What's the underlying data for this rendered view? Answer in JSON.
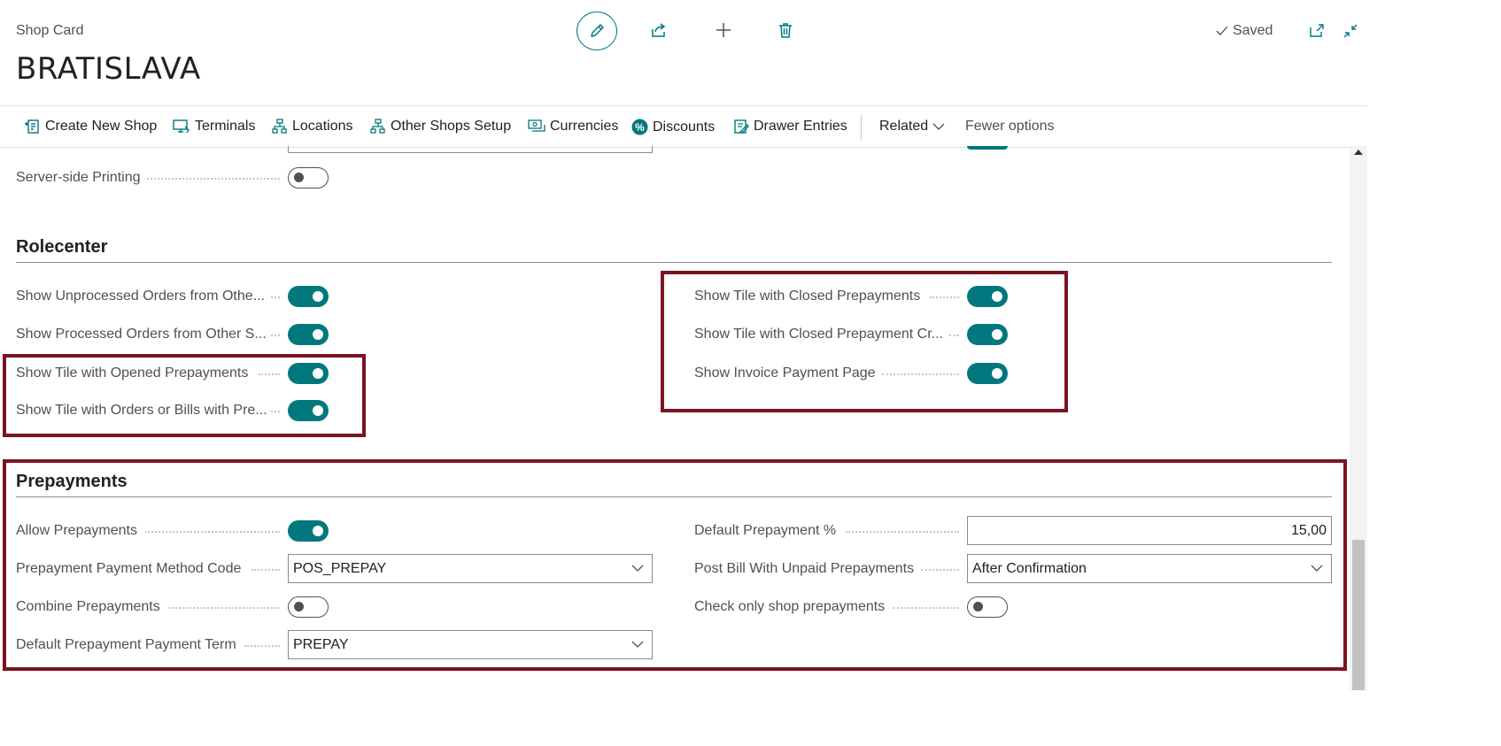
{
  "header": {
    "caption": "Shop Card",
    "title": "BRATISLAVA",
    "status": "Saved"
  },
  "actions": [
    {
      "label": "Create New Shop",
      "icon": "create-document-icon"
    },
    {
      "label": "Terminals",
      "icon": "terminal-icon"
    },
    {
      "label": "Locations",
      "icon": "hierarchy-icon"
    },
    {
      "label": "Other Shops Setup",
      "icon": "hierarchy-icon"
    },
    {
      "label": "Currencies",
      "icon": "currency-icon"
    },
    {
      "label": "Discounts",
      "icon": "percent-icon"
    },
    {
      "label": "Drawer Entries",
      "icon": "entries-icon"
    }
  ],
  "related": "Related",
  "fewer_options": "Fewer options",
  "general": {
    "server_printing": {
      "label": "Server-side Printing",
      "value": false
    }
  },
  "rolecenter": {
    "title": "Rolecenter",
    "left": [
      {
        "label": "Show Unprocessed Orders from Othe...",
        "value": true
      },
      {
        "label": "Show Processed Orders from Other S...",
        "value": true
      },
      {
        "label": "Show Tile with Opened Prepayments",
        "value": true
      },
      {
        "label": "Show Tile with Orders or Bills with Pre...",
        "value": true
      }
    ],
    "right": [
      {
        "label": "Show Tile with Closed Prepayments",
        "value": true
      },
      {
        "label": "Show Tile with Closed Prepayment Cr...",
        "value": true
      },
      {
        "label": "Show Invoice Payment Page",
        "value": true
      }
    ]
  },
  "prepayments": {
    "title": "Prepayments",
    "allow": {
      "label": "Allow Prepayments",
      "value": true
    },
    "method_code": {
      "label": "Prepayment Payment Method Code",
      "value": "POS_PREPAY"
    },
    "combine": {
      "label": "Combine Prepayments",
      "value": false
    },
    "payment_term": {
      "label": "Default Prepayment Payment Term",
      "value": "PREPAY"
    },
    "default_pct": {
      "label": "Default Prepayment %",
      "value": "15,00"
    },
    "post_bill": {
      "label": "Post Bill With Unpaid Prepayments",
      "value": "After Confirmation"
    },
    "check_shop": {
      "label": "Check only shop prepayments",
      "value": false
    }
  },
  "colors": {
    "accent": "#00787e",
    "highlight": "#7a1420"
  }
}
